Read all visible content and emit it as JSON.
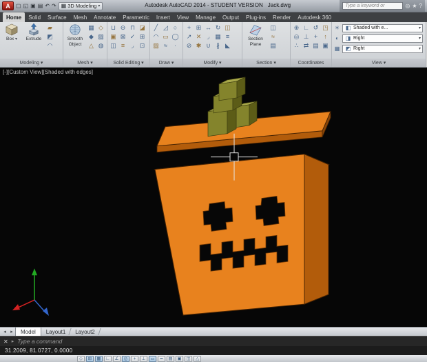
{
  "titlebar": {
    "app_logo": "A",
    "workspace": "3D Modeling",
    "title": "Autodesk AutoCAD 2014 - STUDENT VERSION",
    "doc": "Jack.dwg",
    "search_placeholder": "Type a keyword or"
  },
  "ribbon": {
    "tabs": [
      "Home",
      "Solid",
      "Surface",
      "Mesh",
      "Annotate",
      "Parametric",
      "Insert",
      "View",
      "Manage",
      "Output",
      "Plug-ins",
      "Render",
      "Autodesk 360"
    ],
    "active_tab": "Home",
    "panels": {
      "modeling": {
        "label": "Modeling ▾",
        "box": "Box",
        "extrude": "Extrude"
      },
      "mesh": {
        "label": "Mesh ▾",
        "smooth": "Smooth Object"
      },
      "solid_editing": {
        "label": "Solid Editing ▾"
      },
      "draw": {
        "label": "Draw ▾"
      },
      "modify": {
        "label": "Modify ▾"
      },
      "section": {
        "label": "Section ▾",
        "section_plane": "Section Plane"
      },
      "coordinates": {
        "label": "Coordinates"
      },
      "view": {
        "label": "View ▾",
        "visual_style": "Shaded with e...",
        "named_view": "Right",
        "ucs_view": "Right"
      }
    }
  },
  "viewport": {
    "label": "[-][Custom View][Shaded with edges]"
  },
  "model_colors": {
    "pumpkin": "#e8821e",
    "pumpkin_dark": "#b25c0b",
    "pumpkin_deep": "#8a4507",
    "stem_light": "#a9a94a",
    "stem": "#84842c",
    "stem_dark": "#5c5c17",
    "cutout": "#070707",
    "axis_x": "#d42222",
    "axis_y": "#22aa22",
    "axis_z": "#3366cc"
  },
  "layout_tabs": {
    "items": [
      "Model",
      "Layout1",
      "Layout2"
    ],
    "active": "Model"
  },
  "command_line": {
    "prompt": "Type a command"
  },
  "status": {
    "coordinates": "31.2009, 81.0727, 0.0000"
  },
  "icons": {
    "new-file": "▢",
    "open-file": "◱",
    "save-file": "▣",
    "plot": "▤",
    "undo": "↶",
    "redo": "↷",
    "dropdown": "▾",
    "workspace": "▦",
    "search": "◎",
    "favorites": "★",
    "help": "?",
    "close": "✕",
    "cmd-more": "▸",
    "tab-left": "◂",
    "tab-right": "▸",
    "polysolid": "▰",
    "presspull": "◩",
    "sweep": "◠",
    "mesh-primitive": "▦",
    "smooth-more": "◇",
    "smooth-less": "◆",
    "mesh-refine": "▨",
    "mesh-crease": "△",
    "mesh-revolve": "◍",
    "union": "⊔",
    "subtract": "⊖",
    "intersect": "⊓",
    "slice": "◪",
    "shell": "▣",
    "interfere": "⊠",
    "solid-check": "✓",
    "imprint": "⊞",
    "separate": "◫",
    "offset-edge": "≡",
    "fillet-edge": "◞",
    "extrude-face": "⊡",
    "draw-line": "╱",
    "draw-polyline": "◿",
    "draw-circle": "○",
    "draw-arc": "◠",
    "draw-rect": "▭",
    "draw-ellipse": "◯",
    "draw-hatch": "▨",
    "draw-spline": "≈",
    "draw-point": "∙",
    "move": "+",
    "copy": "⊞",
    "stretch": "↔",
    "rotate": "↻",
    "mirror": "◫",
    "scale": "↗",
    "trim": "✕",
    "fillet": "◞",
    "array": "▦",
    "offset": "≡",
    "erase": "⊘",
    "explode": "✱",
    "join": "∪",
    "break": "∦",
    "chamfer": "◣",
    "live-section": "◫",
    "add-jog": "≈",
    "generate-section": "▤",
    "ucs-world": "⊕",
    "ucs": "∟",
    "ucs-previous": "↺",
    "ucs-face": "◳",
    "ucs-object": "◎",
    "ucs-view": "⊥",
    "ucs-origin": "+",
    "ucs-z-axis": "↑",
    "ucs-3point": "∴",
    "ucs-x": "⇄",
    "ucs-named": "▤",
    "ucs-icon-show": "▣",
    "sun": "☀",
    "materials": "◐",
    "visual-style-cube": "◧",
    "view-cube": "◨",
    "ucs-combo-cube": "◩",
    "status-infer": "◇",
    "status-snap": "⊞",
    "status-grid": "▦",
    "status-ortho": "∟",
    "status-polar": "∠",
    "status-osnap": "◎",
    "status-otrack": "+",
    "status-ducs": "⊥",
    "status-dyn": "▭",
    "status-lwt": "━",
    "status-tpy": "▤",
    "status-qp": "▣",
    "status-sc": "◫",
    "status-am": "△"
  }
}
